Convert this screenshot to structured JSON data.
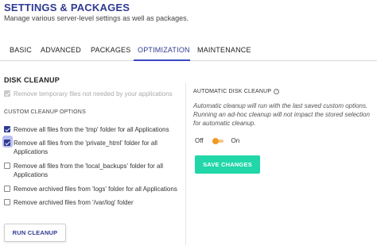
{
  "header": {
    "title": "SETTINGS & PACKAGES",
    "subtitle": "Manage various server-level settings as well as packages."
  },
  "tabs": [
    {
      "label": "BASIC",
      "active": false
    },
    {
      "label": "ADVANCED",
      "active": false
    },
    {
      "label": "PACKAGES",
      "active": false
    },
    {
      "label": "OPTIMIZATION",
      "active": true
    },
    {
      "label": "MAINTENANCE",
      "active": false
    }
  ],
  "disk_cleanup": {
    "title": "DISK CLEANUP",
    "remove_temporary_label": "Remove temporary files not needed by your applications",
    "custom_options_title": "CUSTOM CLEANUP OPTIONS",
    "options": [
      {
        "label": "Remove all files from the 'tmp' folder for all Applications",
        "checked": true
      },
      {
        "label": "Remove all files from the 'private_html' folder for all Applications",
        "checked": true
      },
      {
        "label": "Remove all files from the 'local_backups' folder for all Applications",
        "checked": false
      },
      {
        "label": "Remove archived files from 'logs' folder for all Applications",
        "checked": false
      },
      {
        "label": "Remove archived files from '/var/log' folder",
        "checked": false
      }
    ],
    "run_button": "RUN CLEANUP"
  },
  "automatic": {
    "title": "AUTOMATIC DISK CLEANUP",
    "info_icon_glyph": "?",
    "description": "Automatic cleanup will run with the last saved custom options. Running an ad-hoc cleanup will not impact the stored selection for automatic cleanup.",
    "off_label": "Off",
    "on_label": "On",
    "save_button": "SAVE CHANGES"
  },
  "colors": {
    "brand": "#2f3a93",
    "accent_green": "#21d6a8",
    "toggle_orange": "#f29a23"
  }
}
